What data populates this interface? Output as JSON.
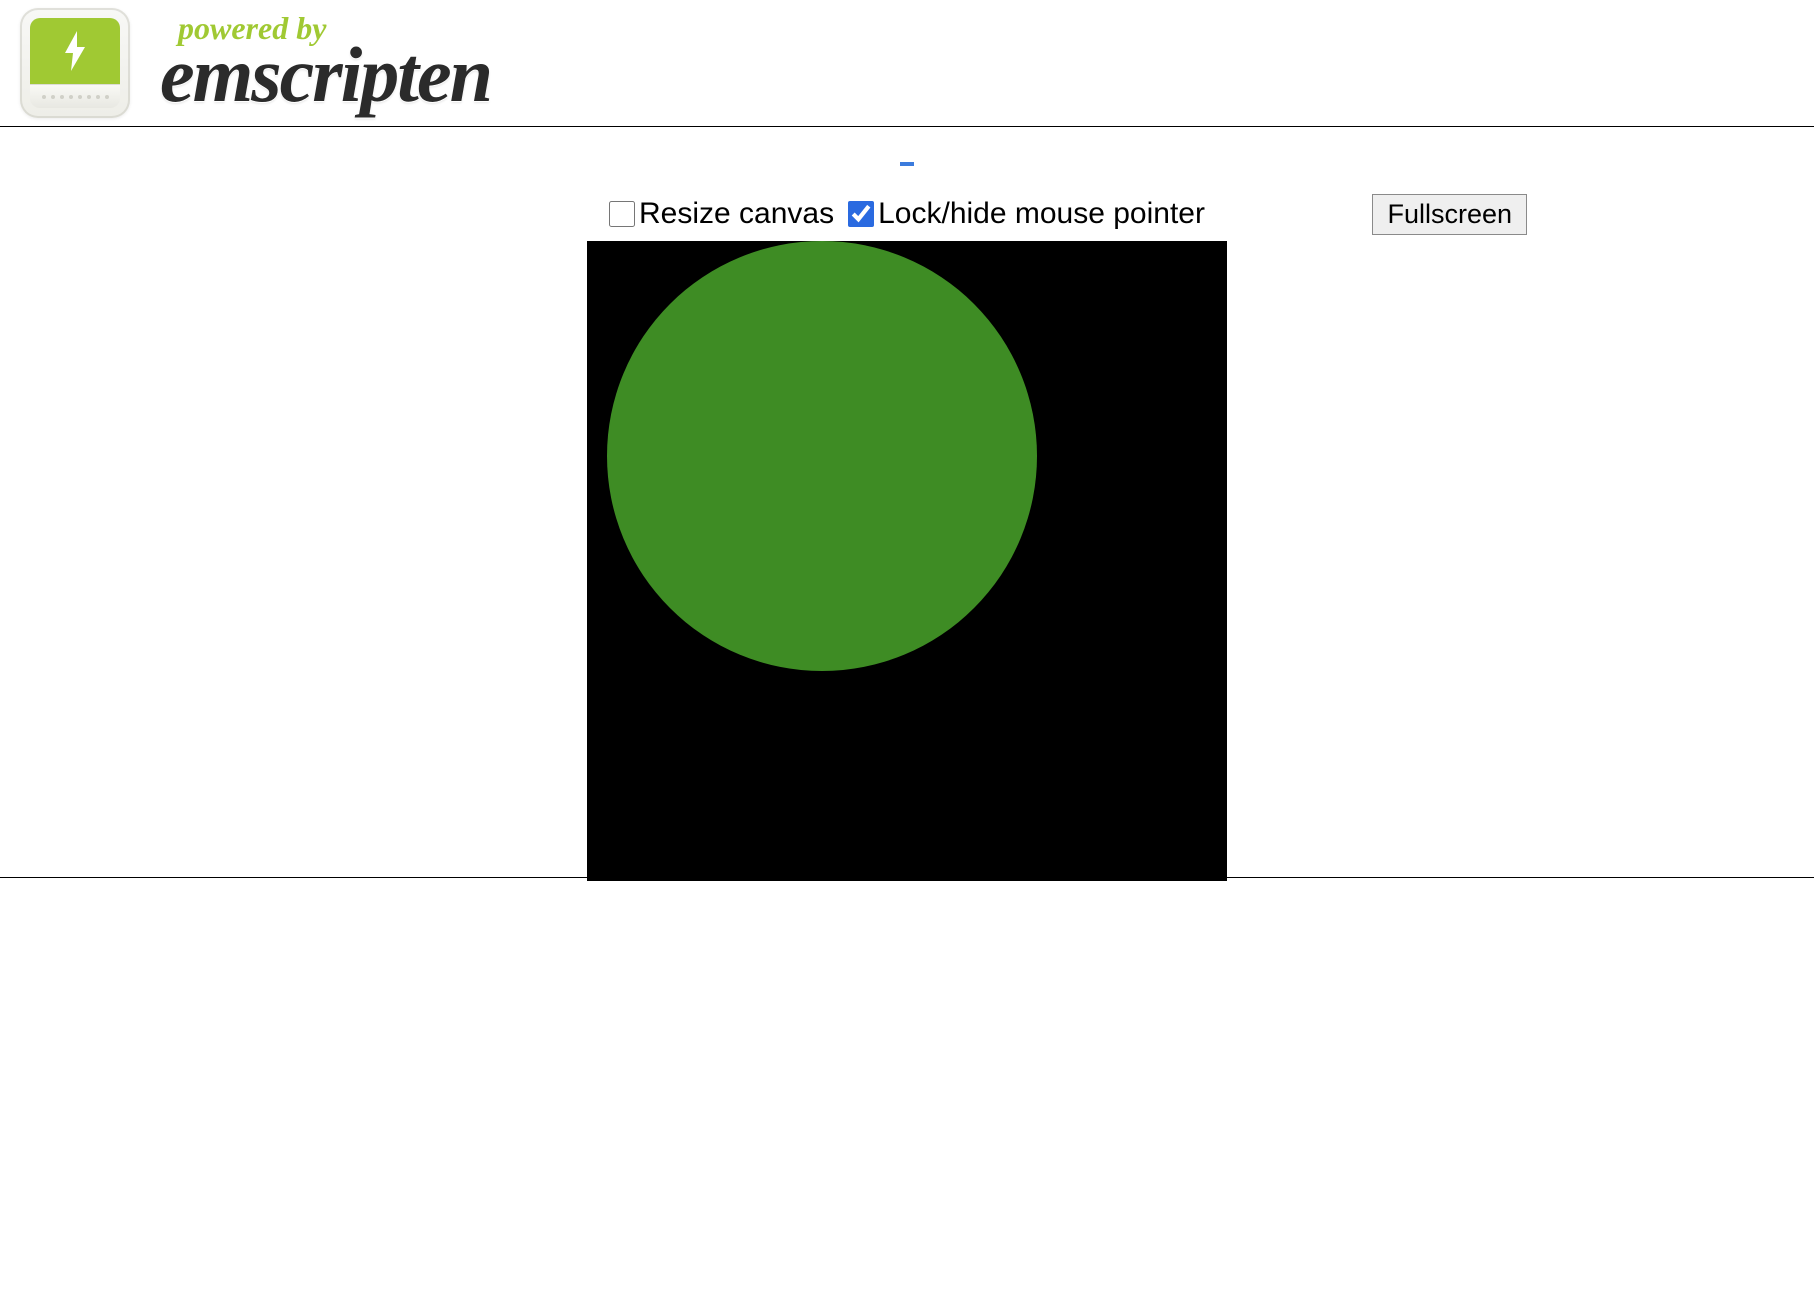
{
  "header": {
    "powered_by": "powered by",
    "brand": "emscripten"
  },
  "controls": {
    "resize_label": "Resize canvas",
    "resize_checked": false,
    "lock_label": "Lock/hide mouse pointer",
    "lock_checked": true,
    "fullscreen_label": "Fullscreen"
  },
  "canvas": {
    "background": "#000000",
    "circle_color": "#3e8c24"
  }
}
